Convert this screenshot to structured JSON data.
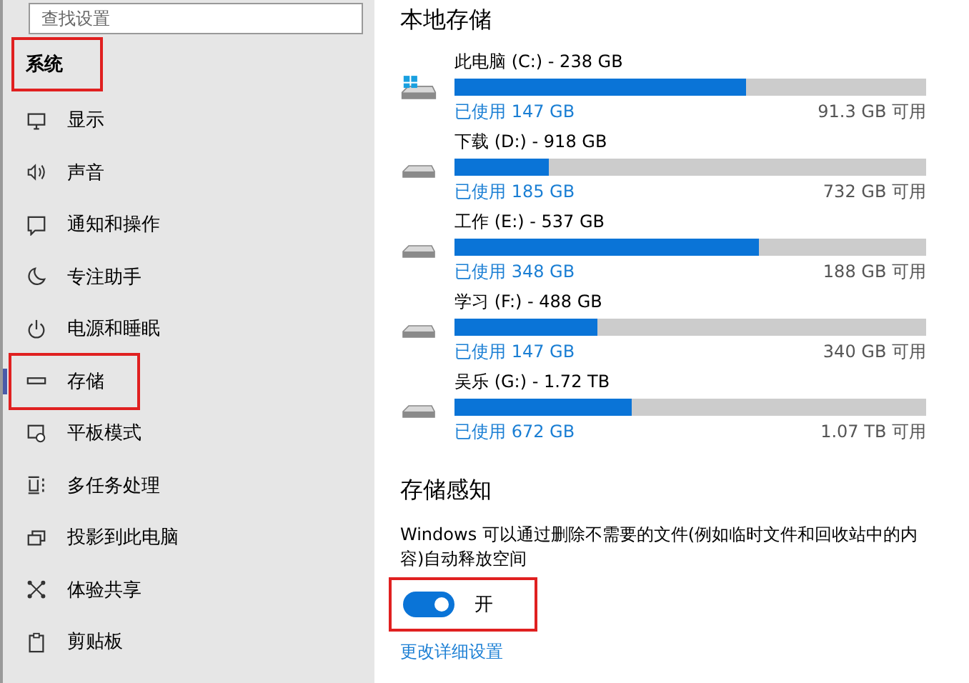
{
  "sidebar": {
    "search": {
      "placeholder": "查找设置"
    },
    "header": {
      "label": "系统",
      "annotated": true
    },
    "items": [
      {
        "label": "显示",
        "selected": false,
        "annotated": false
      },
      {
        "label": "声音",
        "selected": false,
        "annotated": false
      },
      {
        "label": "通知和操作",
        "selected": false,
        "annotated": false
      },
      {
        "label": "专注助手",
        "selected": false,
        "annotated": false
      },
      {
        "label": "电源和睡眠",
        "selected": false,
        "annotated": false
      },
      {
        "label": "存储",
        "selected": true,
        "annotated": true
      },
      {
        "label": "平板模式",
        "selected": false,
        "annotated": false
      },
      {
        "label": "多任务处理",
        "selected": false,
        "annotated": false
      },
      {
        "label": "投影到此电脑",
        "selected": false,
        "annotated": false
      },
      {
        "label": "体验共享",
        "selected": false,
        "annotated": false
      },
      {
        "label": "剪贴板",
        "selected": false,
        "annotated": false
      }
    ]
  },
  "main": {
    "heading": "本地存储",
    "drives": [
      {
        "kind": "system",
        "name": "此电脑 (C:) - 238 GB",
        "level": 0.617,
        "used": "已使用 147 GB",
        "free": "91.3 GB 可用"
      },
      {
        "kind": "data",
        "name": "下载 (D:) - 918 GB",
        "level": 0.2,
        "used": "已使用 185 GB",
        "free": "732 GB 可用"
      },
      {
        "kind": "data",
        "name": "工作 (E:) - 537 GB",
        "level": 0.645,
        "used": "已使用 348 GB",
        "free": "188 GB 可用"
      },
      {
        "kind": "data",
        "name": "学习 (F:) - 488 GB",
        "level": 0.302,
        "used": "已使用 147 GB",
        "free": "340 GB 可用"
      },
      {
        "kind": "data",
        "name": "吴乐 (G:) - 1.72 TB",
        "level": 0.375,
        "used": "已使用 672 GB",
        "free": "1.07 TB 可用"
      }
    ],
    "sense": {
      "heading": "存储感知",
      "description": "Windows 可以通过删除不需要的文件(例如临时文件和回收站中的内容)自动释放空间",
      "toggle": {
        "on": true,
        "label": "开",
        "annotated": true
      },
      "link": "更改详细设置"
    }
  }
}
